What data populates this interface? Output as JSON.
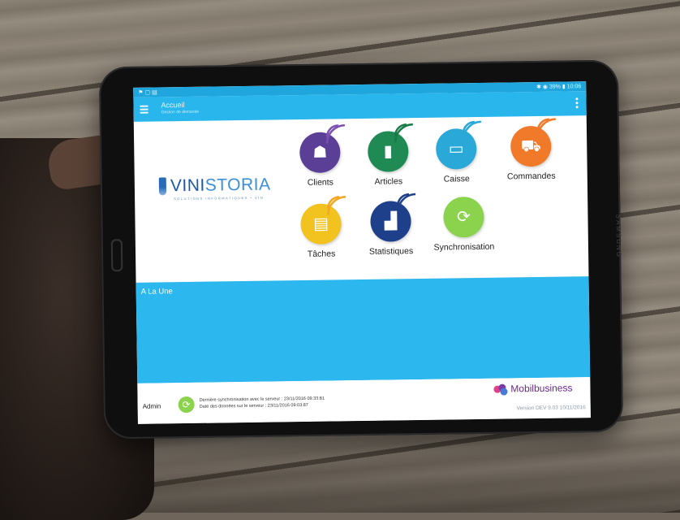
{
  "statusbar": {
    "left": "⚑ ▢ ▤",
    "right": "✱ ◉ 39% ▮ 10:06"
  },
  "appbar": {
    "title": "Accueil",
    "subtitle": "Gestion de demande"
  },
  "logo": {
    "part1": "VINI",
    "part2": "STORIA",
    "tagline": "SOLUTIONS INFORMATIQUES • VIN"
  },
  "tiles": [
    {
      "label": "Clients",
      "color": "#5b3f96",
      "icon": "clients-icon",
      "glyph": "☗"
    },
    {
      "label": "Articles",
      "color": "#1f8a54",
      "icon": "articles-icon",
      "glyph": "▮"
    },
    {
      "label": "Caisse",
      "color": "#2aa8d8",
      "icon": "caisse-icon",
      "glyph": "▭"
    },
    {
      "label": "Commandes",
      "color": "#f07a2a",
      "icon": "commandes-icon",
      "glyph": "⛟"
    },
    {
      "label": "Tâches",
      "color": "#f2c21f",
      "icon": "taches-icon",
      "glyph": "▤"
    },
    {
      "label": "Statistiques",
      "color": "#1e3f8a",
      "icon": "statistiques-icon",
      "glyph": "▟"
    },
    {
      "label": "Synchronisation",
      "color": "#8bd24d",
      "icon": "synchronisation-icon",
      "glyph": "⟳"
    }
  ],
  "news": {
    "title": "A La Une"
  },
  "footer": {
    "admin": "Admin",
    "sync_line_1": "Dernière synchronisation avec le serveur : 23/11/2016 09:33:81",
    "sync_line_2": "Date des données sur le serveur : 23/11/2016 09:03:87",
    "brand": "Mobilbusiness",
    "version": "Version DEV 9.03 10/11/2016"
  },
  "device_brand": "SAMSUNG",
  "colors": {
    "appbar": "#29b6ec",
    "news": "#2cb7ee",
    "statusbar": "#1fa6dc"
  }
}
